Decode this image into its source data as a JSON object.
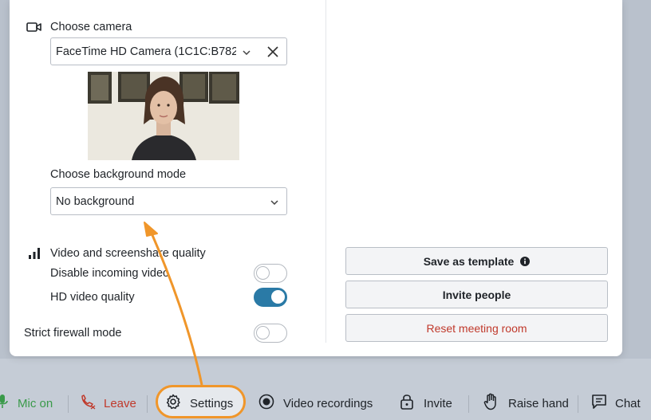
{
  "camera": {
    "section_label": "Choose camera",
    "selected": "FaceTime HD Camera (1C1C:B782)",
    "icon": "video-camera-icon"
  },
  "background": {
    "label": "Choose background mode",
    "selected": "No background"
  },
  "quality": {
    "label": "Video and screenshare quality",
    "icon": "signal-bars-icon",
    "disable_incoming_label": "Disable incoming video",
    "disable_incoming_on": false,
    "hd_label": "HD video quality",
    "hd_on": true
  },
  "firewall": {
    "label": "Strict firewall mode",
    "on": false
  },
  "actions": {
    "save_template": "Save as template",
    "invite_people": "Invite people",
    "reset_room": "Reset meeting room"
  },
  "toolbar": {
    "mic": "Mic on",
    "leave": "Leave",
    "settings": "Settings",
    "recordings": "Video recordings",
    "invite": "Invite",
    "raise_hand": "Raise hand",
    "chat": "Chat"
  },
  "colors": {
    "accent": "#2a7aa6",
    "highlight": "#f0962a",
    "danger": "#c0392b",
    "mic_green": "#3a9a4a"
  }
}
